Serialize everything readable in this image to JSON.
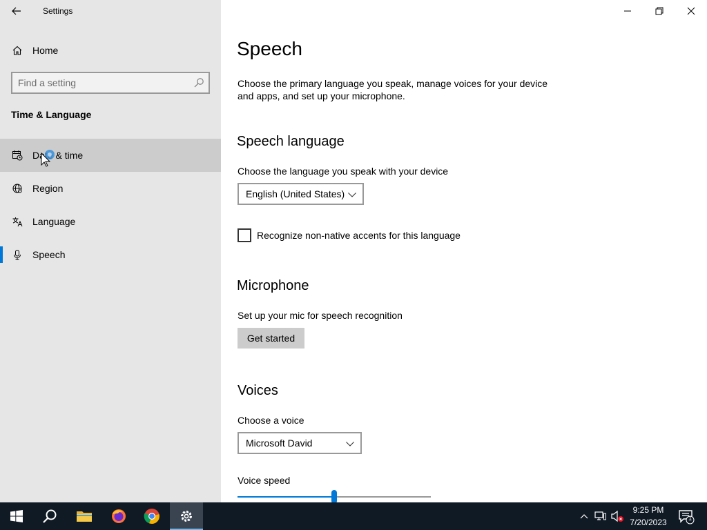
{
  "window": {
    "title": "Settings"
  },
  "sidebar": {
    "home_label": "Home",
    "search_placeholder": "Find a setting",
    "section_label": "Time & Language",
    "items": [
      {
        "label": "Date & time",
        "icon": "calendar-clock-icon",
        "state": "hover"
      },
      {
        "label": "Region",
        "icon": "globe-icon"
      },
      {
        "label": "Language",
        "icon": "language-icon"
      },
      {
        "label": "Speech",
        "icon": "microphone-icon",
        "state": "selected"
      }
    ]
  },
  "main": {
    "title": "Speech",
    "description": "Choose the primary language you speak, manage voices for your device and apps, and set up your microphone.",
    "speech_language": {
      "heading": "Speech language",
      "prompt": "Choose the language you speak with your device",
      "selected": "English (United States)",
      "checkbox_label": "Recognize non-native accents for this language",
      "checkbox_checked": false
    },
    "microphone": {
      "heading": "Microphone",
      "prompt": "Set up your mic for speech recognition",
      "button_label": "Get started"
    },
    "voices": {
      "heading": "Voices",
      "prompt": "Choose a voice",
      "selected": "Microsoft David",
      "speed_label": "Voice speed",
      "speed_fraction": 0.5
    }
  },
  "taskbar": {
    "apps": [
      "windows-start-icon",
      "search-icon",
      "file-explorer-icon",
      "firefox-icon",
      "chrome-icon",
      "settings-gear-icon"
    ],
    "active_app": "settings-gear-icon",
    "time": "9:25 PM",
    "date": "7/20/2023",
    "notification_count": "1"
  },
  "colors": {
    "accent": "#0078d7",
    "sidebar_bg": "#e6e6e6",
    "taskbar_bg": "#101a25"
  }
}
